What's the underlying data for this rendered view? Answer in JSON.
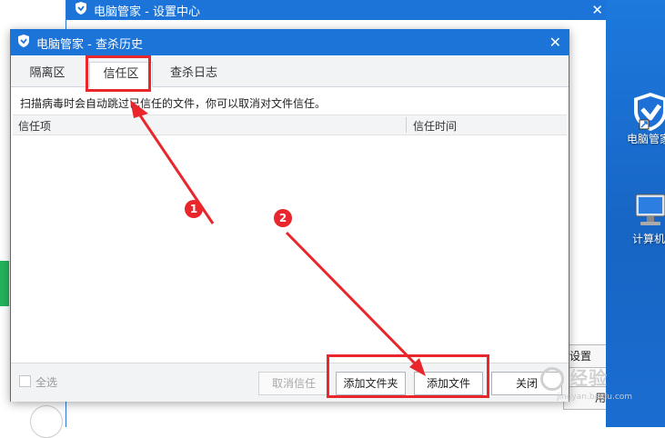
{
  "back_window": {
    "title": "电脑管家 - 设置中心",
    "close": "✕",
    "btn_settings": "设置",
    "btn_use": "用"
  },
  "dialog": {
    "title": "电脑管家 - 查杀历史",
    "close": "✕",
    "tabs": [
      {
        "label": "隔离区"
      },
      {
        "label": "信任区"
      },
      {
        "label": "查杀日志"
      }
    ],
    "hint": "扫描病毒时会自动跳过已信任的文件，你可以取消对文件信任。",
    "columns": [
      "信任项",
      "信任时间"
    ],
    "footer": {
      "select_all": "全选",
      "btn_cancel_trust": "取消信任",
      "btn_add_folder": "添加文件夹",
      "btn_add_file": "添加文件",
      "btn_close": "关闭"
    }
  },
  "desktop": {
    "icons": [
      {
        "label": "电脑管家"
      },
      {
        "label": "计算机"
      }
    ]
  },
  "annotations": {
    "badge1": "1",
    "badge2": "2",
    "color": "#e8262b"
  },
  "watermark": {
    "text": "经验",
    "url": "jingyan.baidu.com"
  },
  "colors": {
    "accent": "#1d74d8",
    "annotation": "#e8262b"
  }
}
